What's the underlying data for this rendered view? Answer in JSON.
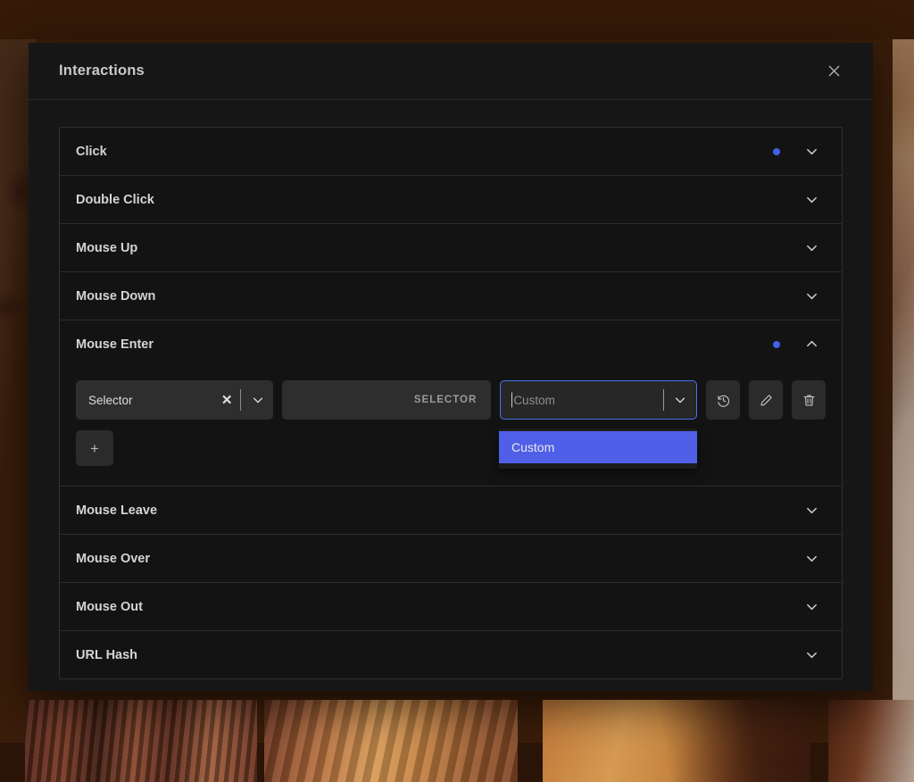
{
  "modal": {
    "title": "Interactions",
    "close_icon": "close-icon"
  },
  "interactions": [
    {
      "label": "Click",
      "has_dot": true,
      "expanded": false,
      "chevron": "chevron-down-icon"
    },
    {
      "label": "Double Click",
      "has_dot": false,
      "expanded": false,
      "chevron": "chevron-down-icon"
    },
    {
      "label": "Mouse Up",
      "has_dot": false,
      "expanded": false,
      "chevron": "chevron-down-icon"
    },
    {
      "label": "Mouse Down",
      "has_dot": false,
      "expanded": false,
      "chevron": "chevron-down-icon"
    },
    {
      "label": "Mouse Enter",
      "has_dot": true,
      "expanded": true,
      "chevron": "chevron-up-icon"
    },
    {
      "label": "Mouse Leave",
      "has_dot": false,
      "expanded": false,
      "chevron": "chevron-down-icon"
    },
    {
      "label": "Mouse Over",
      "has_dot": false,
      "expanded": false,
      "chevron": "chevron-down-icon"
    },
    {
      "label": "Mouse Out",
      "has_dot": false,
      "expanded": false,
      "chevron": "chevron-down-icon"
    },
    {
      "label": "URL Hash",
      "has_dot": false,
      "expanded": false,
      "chevron": "chevron-down-icon"
    }
  ],
  "expanded_row": {
    "trigger_select": {
      "value": "Selector",
      "clear_label": "✕"
    },
    "selector_field": {
      "value": "",
      "placeholder": "SELECTOR"
    },
    "action_combo": {
      "value": "",
      "placeholder": "Custom",
      "focused": true
    },
    "dropdown": {
      "open": true,
      "options": [
        {
          "label": "Custom",
          "selected": true
        }
      ]
    },
    "action_buttons": [
      {
        "name": "history-icon",
        "title": "History"
      },
      {
        "name": "edit-icon",
        "title": "Edit"
      },
      {
        "name": "trash-icon",
        "title": "Delete"
      }
    ],
    "add_button_label": "+"
  },
  "colors": {
    "accent_blue": "#4361e8",
    "dropdown_highlight": "#4f5fe8",
    "focus_border": "#4a73e8",
    "modal_bg": "#161616",
    "row_bg": "#131313"
  }
}
